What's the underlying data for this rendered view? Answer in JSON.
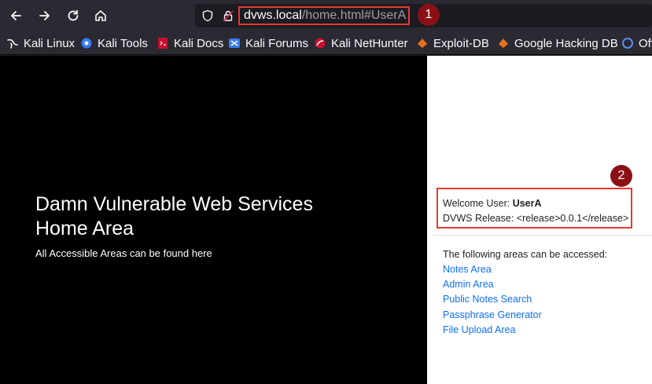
{
  "browser": {
    "url_host": "dvws.local",
    "url_path": "/home.html#UserA",
    "annotations": [
      "1",
      "2"
    ]
  },
  "bookmarks": [
    {
      "label": "Kali Linux",
      "icon": "kali-dragon-icon"
    },
    {
      "label": "Kali Tools",
      "icon": "kali-tools-icon"
    },
    {
      "label": "Kali Docs",
      "icon": "kali-docs-icon"
    },
    {
      "label": "Kali Forums",
      "icon": "kali-forums-icon"
    },
    {
      "label": "Kali NetHunter",
      "icon": "nethunter-icon"
    },
    {
      "label": "Exploit-DB",
      "icon": "exploit-db-icon"
    },
    {
      "label": "Google Hacking DB",
      "icon": "ghdb-icon"
    },
    {
      "label": "Off",
      "icon": "offsec-icon"
    }
  ],
  "hero": {
    "title_line1": "Damn Vulnerable Web Services",
    "title_line2": "Home Area",
    "subtitle": "All Accessible Areas can be found here"
  },
  "welcome": {
    "user_label": "Welcome User: ",
    "user_name": "UserA",
    "release_text": "DVWS Release: <release>0.0.1</release>"
  },
  "areas": {
    "heading": "The following areas can be accessed:",
    "links": [
      "Notes Area",
      "Admin Area",
      "Public Notes Search",
      "Passphrase Generator",
      "File Upload Area"
    ]
  },
  "colors": {
    "annotation_red": "#e53935",
    "badge": "#8b1016",
    "link": "#0d6efd"
  }
}
